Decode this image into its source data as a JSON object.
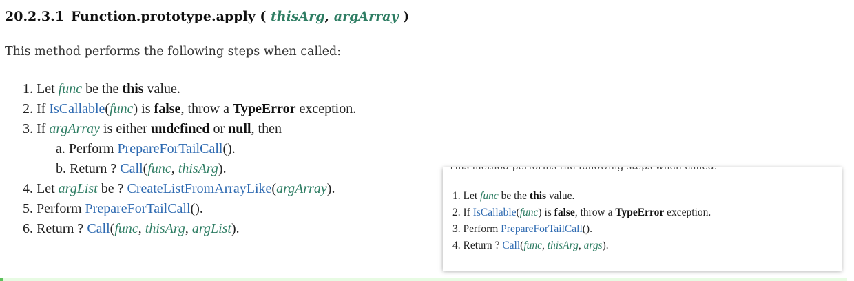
{
  "heading": {
    "number": "20.2.3.1",
    "name": "Function.prototype.apply (",
    "param1": "thisArg",
    "comma": ",",
    "param2": "argArray",
    "close": ")"
  },
  "intro": "This method performs the following steps when called:",
  "steps": {
    "s1": {
      "num": "1.",
      "t1": "Let",
      "v1": "func",
      "t2": "be the",
      "b1": "this",
      "t3": "value."
    },
    "s2": {
      "num": "2.",
      "t1": "If",
      "l1": "IsCallable",
      "p1": "(",
      "v1": "func",
      "p2": ")",
      "t2": "is",
      "b1": "false",
      "t3": ", throw a",
      "b2": "TypeError",
      "t4": "exception."
    },
    "s3": {
      "num": "3.",
      "t1": "If",
      "v1": "argArray",
      "t2": "is either",
      "b1": "undefined",
      "t3": "or",
      "b2": "null",
      "t4": ", then"
    },
    "s3a": {
      "num": "a.",
      "t1": "Perform",
      "l1": "PrepareForTailCall",
      "p1": "()."
    },
    "s3b": {
      "num": "b.",
      "t1": "Return ?",
      "l1": "Call",
      "p1": "(",
      "v1": "func",
      "p2": ",",
      "v2": "thisArg",
      "p3": ")."
    },
    "s4": {
      "num": "4.",
      "t1": "Let",
      "v1": "argList",
      "t2": "be ?",
      "l1": "CreateListFromArrayLike",
      "p1": "(",
      "v2": "argArray",
      "p2": ")."
    },
    "s5": {
      "num": "5.",
      "t1": "Perform",
      "l1": "PrepareForTailCall",
      "p1": "()."
    },
    "s6": {
      "num": "6.",
      "t1": "Return ?",
      "l1": "Call",
      "p1": "(",
      "v1": "func",
      "p2": ",",
      "v2": "thisArg",
      "p3": ",",
      "v3": "argList",
      "p4": ")."
    }
  },
  "popup": {
    "clipped_text": "This method performs the following steps when called:",
    "s1": {
      "num": "1.",
      "t1": "Let",
      "v1": "func",
      "t2": "be the",
      "b1": "this",
      "t3": "value."
    },
    "s2": {
      "num": "2.",
      "t1": "If",
      "l1": "IsCallable",
      "p1": "(",
      "v1": "func",
      "p2": ")",
      "t2": "is",
      "b1": "false",
      "t3": ", throw a",
      "b2": "TypeError",
      "t4": "exception."
    },
    "s3": {
      "num": "3.",
      "t1": "Perform",
      "l1": "PrepareForTailCall",
      "p1": "()."
    },
    "s4": {
      "num": "4.",
      "t1": "Return ?",
      "l1": "Call",
      "p1": "(",
      "v1": "func",
      "p2": ",",
      "v2": "thisArg",
      "p3": ",",
      "v3": "args",
      "p4": ")."
    }
  },
  "colors": {
    "variable": "#2e7d63",
    "link": "#2e6ab1",
    "bar_fill": "#e7fbe3",
    "bar_edge": "#5bc15b"
  }
}
